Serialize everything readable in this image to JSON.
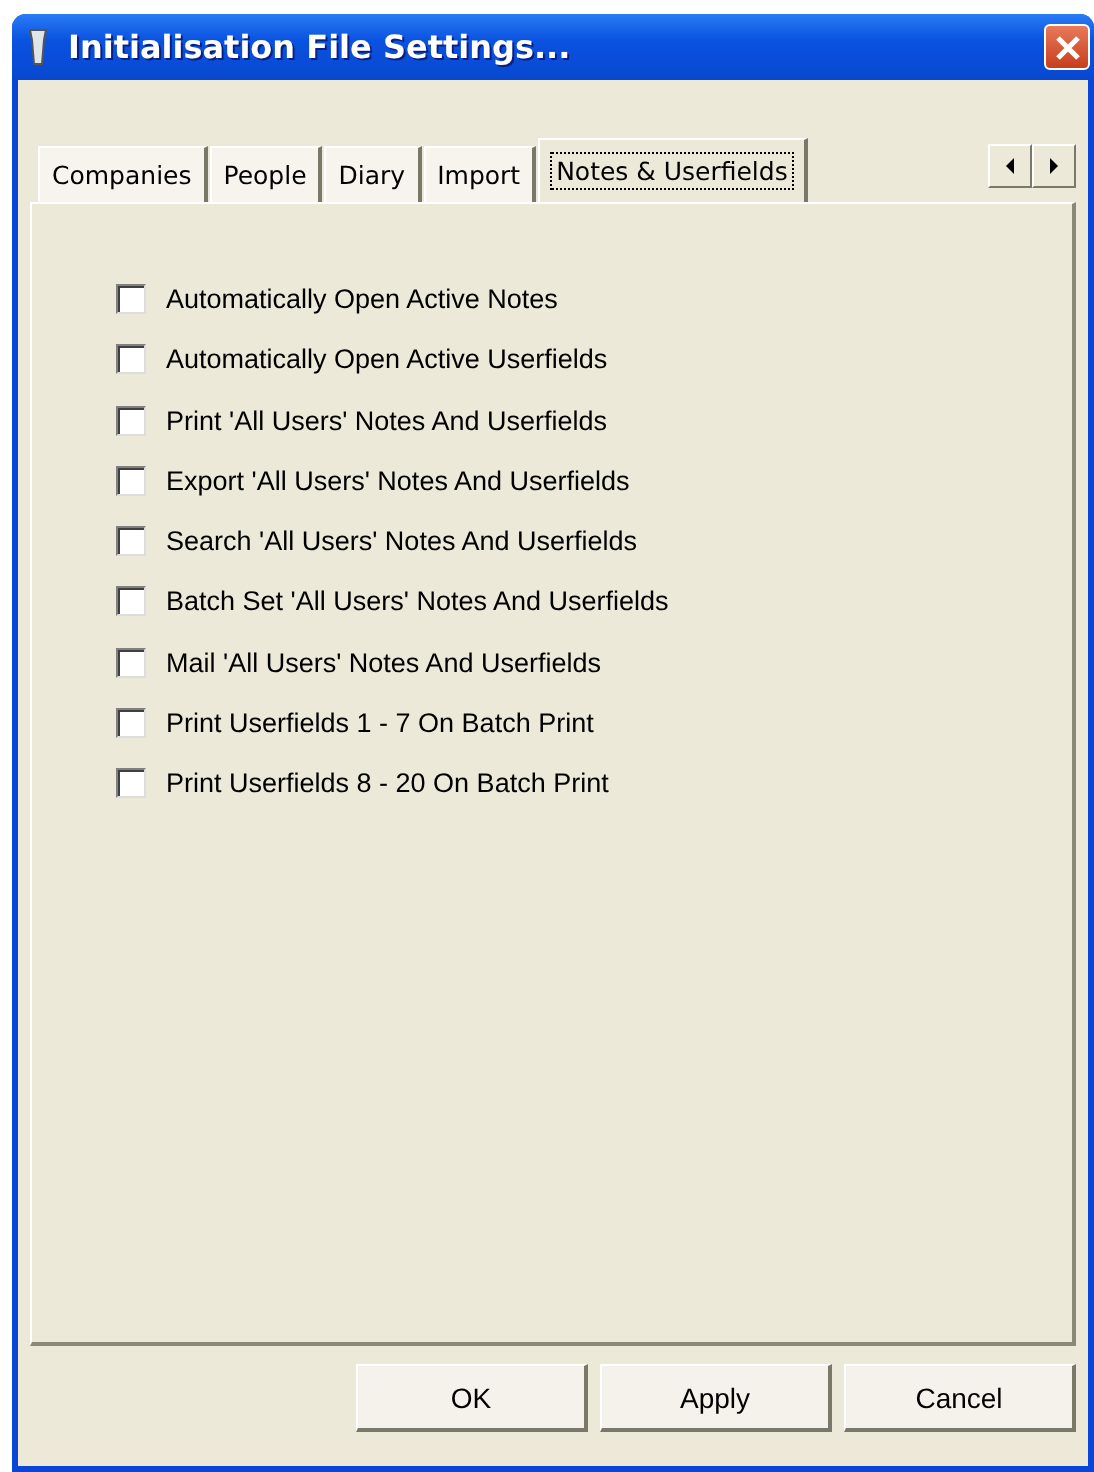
{
  "window": {
    "title": "Initialisation File Settings..."
  },
  "tabs": [
    {
      "label": "Companies",
      "selected": false
    },
    {
      "label": "People",
      "selected": false
    },
    {
      "label": "Diary",
      "selected": false
    },
    {
      "label": "Import",
      "selected": false
    },
    {
      "label": "Notes & Userfields",
      "selected": true
    }
  ],
  "options": [
    {
      "label": "Automatically Open Active Notes",
      "checked": false
    },
    {
      "label": "Automatically Open Active Userfields",
      "checked": false
    },
    {
      "label": "Print 'All Users' Notes And Userfields",
      "checked": false
    },
    {
      "label": "Export 'All Users' Notes And Userfields",
      "checked": false
    },
    {
      "label": "Search 'All Users' Notes And Userfields",
      "checked": false
    },
    {
      "label": "Batch Set 'All Users' Notes And Userfields",
      "checked": false
    },
    {
      "label": "Mail 'All Users' Notes And Userfields",
      "checked": false
    },
    {
      "label": "Print Userfields 1 - 7 On Batch Print",
      "checked": false
    },
    {
      "label": "Print Userfields 8 - 20 On Batch Print",
      "checked": false
    }
  ],
  "buttons": [
    "OK",
    "Apply",
    "Cancel"
  ]
}
